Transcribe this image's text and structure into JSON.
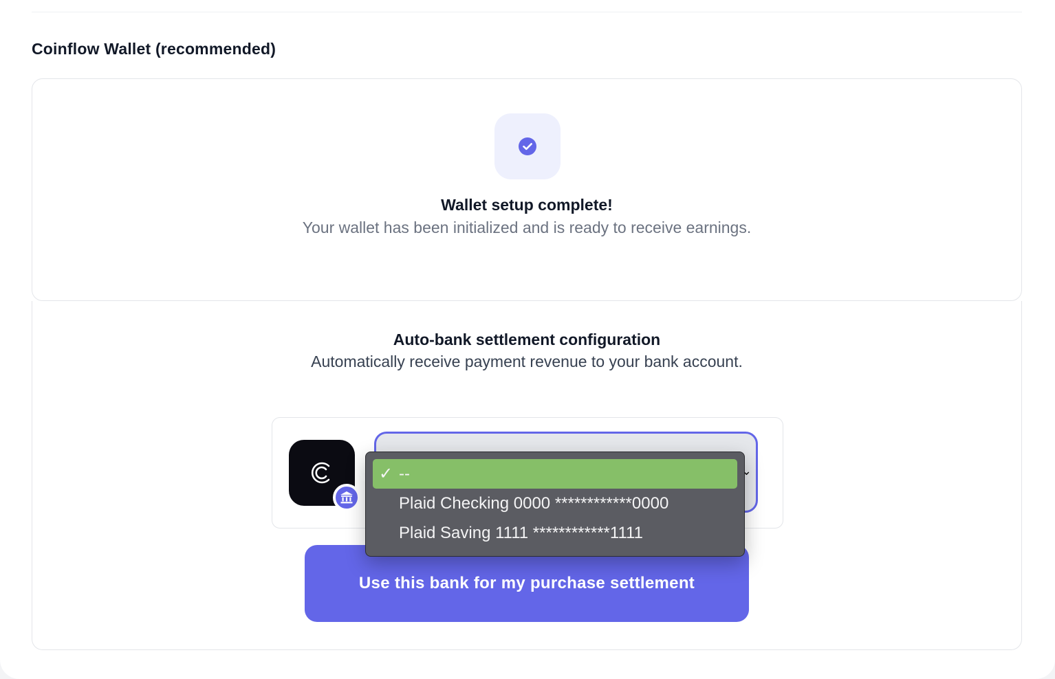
{
  "section": {
    "title": "Coinflow Wallet (recommended)"
  },
  "wallet": {
    "heading": "Wallet setup complete!",
    "description": "Your wallet has been initialized and is ready to receive earnings."
  },
  "settlement": {
    "heading": "Auto-bank settlement configuration",
    "description": "Automatically receive payment revenue to your bank account.",
    "select": {
      "selected_value": "--",
      "options": [
        "--",
        "Plaid Checking 0000 ************0000",
        "Plaid Saving 1111 ************1111"
      ]
    },
    "button_label": "Use this bank for my purchase settlement"
  },
  "icons": {
    "check": "check-circle-icon",
    "logo": "coinflow-logo",
    "bank": "bank-icon",
    "tick": "✓"
  },
  "colors": {
    "accent": "#6366e8",
    "accent_light": "#eef0fd",
    "selected_option": "#86bf68",
    "dropdown_bg": "#5b5c62"
  }
}
